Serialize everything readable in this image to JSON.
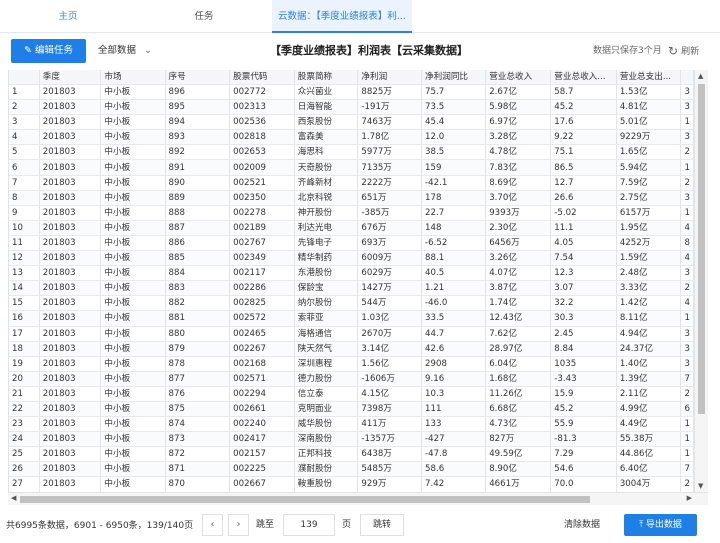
{
  "tabs": [
    {
      "label": "主页"
    },
    {
      "label": "任务"
    },
    {
      "label": "云数据：【季度业绩报表】利..."
    }
  ],
  "toolbar": {
    "edit_label": "编辑任务",
    "edit_icon": "edit-icon",
    "filter_label": "全部数据",
    "title": "【季度业绩报表】利润表【云采集数据】",
    "save_note": "数据只保存3个月",
    "refresh_label": "刷新"
  },
  "table": {
    "columns": [
      "",
      "季度",
      "市场",
      "序号",
      "股票代码",
      "股票简称",
      "净利润",
      "净利润同比",
      "营业总收入",
      "营业总收入...",
      "营业总支出...",
      ""
    ],
    "rows": [
      [
        "1",
        "201803",
        "中小板",
        "896",
        "002772",
        "众兴菌业",
        "8825万",
        "75.7",
        "2.67亿",
        "58.7",
        "1.53亿",
        "3"
      ],
      [
        "2",
        "201803",
        "中小板",
        "895",
        "002313",
        "日海智能",
        "-191万",
        "73.5",
        "5.98亿",
        "45.2",
        "4.81亿",
        "3"
      ],
      [
        "3",
        "201803",
        "中小板",
        "894",
        "002536",
        "西泵股份",
        "7463万",
        "45.4",
        "6.97亿",
        "17.6",
        "5.01亿",
        "1"
      ],
      [
        "4",
        "201803",
        "中小板",
        "893",
        "002818",
        "富森美",
        "1.78亿",
        "12.0",
        "3.28亿",
        "9.22",
        "9229万",
        "3"
      ],
      [
        "5",
        "201803",
        "中小板",
        "892",
        "002653",
        "海思科",
        "5977万",
        "38.5",
        "4.78亿",
        "75.1",
        "1.65亿",
        "2"
      ],
      [
        "6",
        "201803",
        "中小板",
        "891",
        "002009",
        "天奇股份",
        "7135万",
        "159",
        "7.83亿",
        "86.5",
        "5.94亿",
        "1"
      ],
      [
        "7",
        "201803",
        "中小板",
        "890",
        "002521",
        "齐峰新材",
        "2222万",
        "-42.1",
        "8.69亿",
        "12.7",
        "7.59亿",
        "2"
      ],
      [
        "8",
        "201803",
        "中小板",
        "889",
        "002350",
        "北京科锐",
        "651万",
        "178",
        "3.70亿",
        "26.6",
        "2.75亿",
        "3"
      ],
      [
        "9",
        "201803",
        "中小板",
        "888",
        "002278",
        "神开股份",
        "-385万",
        "22.7",
        "9393万",
        "-5.02",
        "6157万",
        "1"
      ],
      [
        "10",
        "201803",
        "中小板",
        "887",
        "002189",
        "利达光电",
        "676万",
        "148",
        "2.30亿",
        "11.1",
        "1.95亿",
        "4"
      ],
      [
        "11",
        "201803",
        "中小板",
        "886",
        "002767",
        "先锋电子",
        "693万",
        "-6.52",
        "6456万",
        "4.05",
        "4252万",
        "8"
      ],
      [
        "12",
        "201803",
        "中小板",
        "885",
        "002349",
        "精华制药",
        "6009万",
        "88.1",
        "3.26亿",
        "7.54",
        "1.59亿",
        "4"
      ],
      [
        "13",
        "201803",
        "中小板",
        "884",
        "002117",
        "东港股份",
        "6029万",
        "40.5",
        "4.07亿",
        "12.3",
        "2.48亿",
        "3"
      ],
      [
        "14",
        "201803",
        "中小板",
        "883",
        "002286",
        "保龄宝",
        "1427万",
        "1.21",
        "3.87亿",
        "3.07",
        "3.33亿",
        "2"
      ],
      [
        "15",
        "201803",
        "中小板",
        "882",
        "002825",
        "纳尔股份",
        "544万",
        "-46.0",
        "1.74亿",
        "32.2",
        "1.42亿",
        "4"
      ],
      [
        "16",
        "201803",
        "中小板",
        "881",
        "002572",
        "索菲亚",
        "1.03亿",
        "33.5",
        "12.43亿",
        "30.3",
        "8.11亿",
        "1"
      ],
      [
        "17",
        "201803",
        "中小板",
        "880",
        "002465",
        "海格通信",
        "2670万",
        "44.7",
        "7.62亿",
        "2.45",
        "4.94亿",
        "3"
      ],
      [
        "18",
        "201803",
        "中小板",
        "879",
        "002267",
        "陕天然气",
        "3.14亿",
        "42.6",
        "28.97亿",
        "8.84",
        "24.37亿",
        "3"
      ],
      [
        "19",
        "201803",
        "中小板",
        "878",
        "002168",
        "深圳惠程",
        "1.56亿",
        "2908",
        "6.04亿",
        "1035",
        "1.40亿",
        "3"
      ],
      [
        "20",
        "201803",
        "中小板",
        "877",
        "002571",
        "德力股份",
        "-1606万",
        "9.16",
        "1.68亿",
        "-3.43",
        "1.39亿",
        "7"
      ],
      [
        "21",
        "201803",
        "中小板",
        "876",
        "002294",
        "信立泰",
        "4.15亿",
        "10.3",
        "11.26亿",
        "15.9",
        "2.11亿",
        "2"
      ],
      [
        "22",
        "201803",
        "中小板",
        "875",
        "002661",
        "克明面业",
        "7398万",
        "111",
        "6.68亿",
        "45.2",
        "4.99亿",
        "6"
      ],
      [
        "23",
        "201803",
        "中小板",
        "874",
        "002240",
        "威华股份",
        "411万",
        "133",
        "4.73亿",
        "55.9",
        "4.49亿",
        "1"
      ],
      [
        "24",
        "201803",
        "中小板",
        "873",
        "002417",
        "深南股份",
        "-1357万",
        "-427",
        "827万",
        "-81.3",
        "55.38万",
        "1"
      ],
      [
        "25",
        "201803",
        "中小板",
        "872",
        "002157",
        "正邦科技",
        "6438万",
        "-47.8",
        "49.59亿",
        "7.29",
        "44.86亿",
        "1"
      ],
      [
        "26",
        "201803",
        "中小板",
        "871",
        "002225",
        "濮耐股份",
        "5485万",
        "58.6",
        "8.90亿",
        "54.6",
        "6.40亿",
        "7"
      ],
      [
        "27",
        "201803",
        "中小板",
        "870",
        "002667",
        "鞍重股份",
        "929万",
        "7.42",
        "4661万",
        "70.0",
        "3004万",
        "2"
      ]
    ]
  },
  "footer": {
    "info": "共6995条数据，6901 - 6950条，139/140页",
    "prev_icon": "chevron-left-icon",
    "next_icon": "chevron-right-icon",
    "goto_label": "跳至",
    "page_value": "139",
    "page_unit": "页",
    "goto_button": "跳转",
    "clear_label": "清除数据",
    "export_label": "导出数据",
    "export_icon": "upload-icon"
  },
  "colors": {
    "accent": "#1e7fe6",
    "tab_active_bg": "#eaf3fe"
  }
}
